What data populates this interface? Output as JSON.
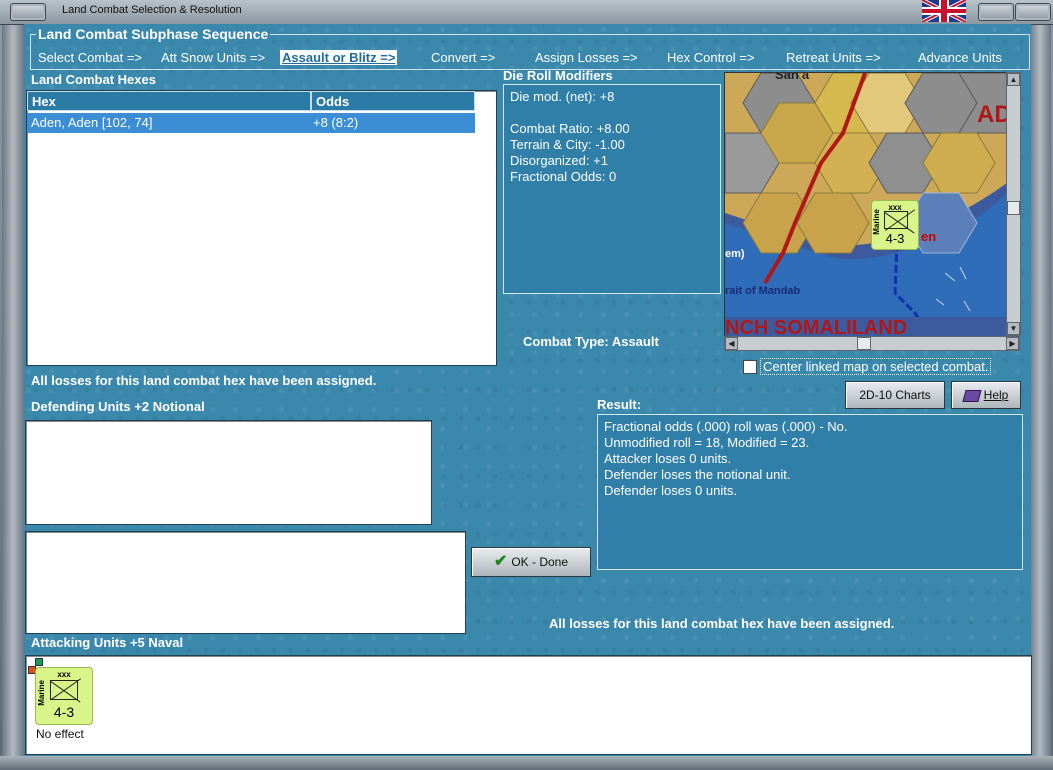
{
  "window": {
    "title": "Land Combat Selection & Resolution"
  },
  "sequence": {
    "title": "Land Combat Subphase Sequence",
    "steps": [
      {
        "label": "Select Combat =>"
      },
      {
        "label": "Att Snow Units =>"
      },
      {
        "label": "Assault or Blitz =>",
        "active": true
      },
      {
        "label": "Convert =>"
      },
      {
        "label": "Assign Losses =>"
      },
      {
        "label": "Hex Control =>"
      },
      {
        "label": "Retreat Units =>"
      },
      {
        "label": "Advance Units"
      }
    ]
  },
  "combat_hexes": {
    "heading": "Land Combat Hexes",
    "columns": [
      "Hex",
      "Odds"
    ],
    "rows": [
      {
        "hex": "Aden, Aden [102, 74]",
        "odds": "+8 (8:2)"
      }
    ],
    "status": "All losses for this land combat hex have been assigned."
  },
  "die_roll": {
    "heading": "Die Roll Modifiers",
    "net": "Die mod. (net): +8",
    "lines": [
      "Combat Ratio: +8.00",
      "Terrain & City: -1.00",
      "Disorganized: +1",
      "Fractional Odds: 0"
    ]
  },
  "combat_type": "Combat Type:  Assault",
  "map": {
    "labels": [
      "San'a",
      "AD",
      "en",
      "em)",
      "rait of Mandab",
      "NCH SOMALILAND"
    ],
    "unit": {
      "type": "Marine",
      "size": "xxx",
      "factors": "4-3"
    }
  },
  "center_map": {
    "label": "Center linked map on selected combat.",
    "checked": false
  },
  "buttons": {
    "charts": "2D-10 Charts",
    "help": "Help",
    "ok": "OK - Done"
  },
  "defending": {
    "heading": "Defending Units +2 Notional"
  },
  "result": {
    "heading": "Result:",
    "lines": [
      "Fractional odds (.000) roll was (.000)  - No.",
      "Unmodified roll = 18, Modified = 23.",
      "Attacker loses 0 units.",
      "Defender loses the notional unit.",
      "Defender loses 0 units."
    ],
    "status": "All losses for this land combat hex have been assigned."
  },
  "attacking": {
    "heading": "Attacking Units +5 Naval",
    "units": [
      {
        "type": "Marine",
        "size": "xxx",
        "factors": "4-3",
        "effect": "No effect"
      }
    ]
  },
  "colors": {
    "panel_bg": "#3a88ac",
    "selection": "#3b8ed4",
    "counter": "#d9f58a",
    "border_red": "#b01818"
  }
}
